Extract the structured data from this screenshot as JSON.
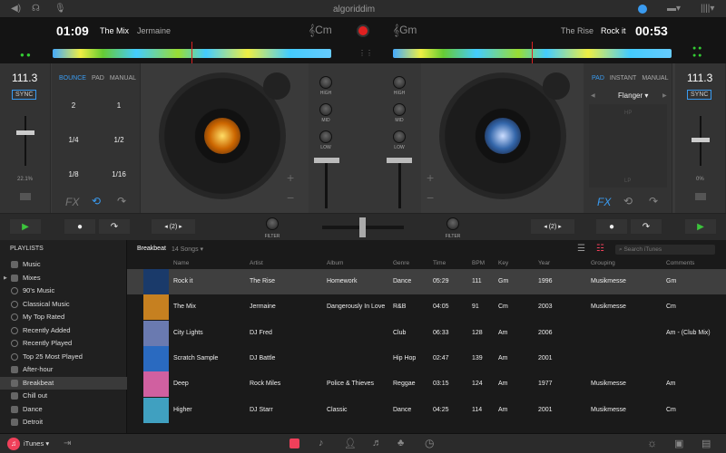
{
  "topbar": {
    "brand": "algoriddim",
    "icons": [
      "speaker-icon",
      "headphones-icon",
      "microphone-icon",
      "sync-icon",
      "layout-icon",
      "columns-icon"
    ]
  },
  "deck_a": {
    "time": "01:09",
    "title": "The Mix",
    "artist": "Jermaine",
    "key": "Cm",
    "bpm": "111.3",
    "sync": "SYNC",
    "pitch": "22.1%",
    "tabs": [
      "BOUNCE",
      "PAD",
      "MANUAL"
    ],
    "active_tab": "BOUNCE",
    "pads": [
      "2",
      "1",
      "1/4",
      "1/2",
      "1/8",
      "1/16"
    ],
    "fx": "FX",
    "loop_value": "2"
  },
  "deck_b": {
    "time": "00:53",
    "title": "Rock it",
    "artist": "The Rise",
    "key": "Gm",
    "bpm": "111.3",
    "sync": "SYNC",
    "pitch": "0%",
    "tabs": [
      "PAD",
      "INSTANT",
      "MANUAL"
    ],
    "active_tab": "PAD",
    "effect": "Flanger",
    "hp": "HP",
    "lp": "LP",
    "fx": "FX",
    "loop_value": "2"
  },
  "mixer": {
    "high": "HIGH",
    "mid": "MID",
    "low": "LOW",
    "filter": "FILTER"
  },
  "library": {
    "sidebar_title": "PLAYLISTS",
    "playlists": [
      {
        "label": "Music",
        "icon": "playlist"
      },
      {
        "label": "Mixes",
        "icon": "folder"
      },
      {
        "label": "90's Music",
        "icon": "smart"
      },
      {
        "label": "Classical Music",
        "icon": "smart"
      },
      {
        "label": "My Top Rated",
        "icon": "smart"
      },
      {
        "label": "Recently Added",
        "icon": "smart"
      },
      {
        "label": "Recently Played",
        "icon": "smart"
      },
      {
        "label": "Top 25 Most Played",
        "icon": "smart"
      },
      {
        "label": "After-hour",
        "icon": "playlist"
      },
      {
        "label": "Breakbeat",
        "icon": "playlist"
      },
      {
        "label": "Chill out",
        "icon": "playlist"
      },
      {
        "label": "Dance",
        "icon": "playlist"
      },
      {
        "label": "Detroit",
        "icon": "playlist"
      }
    ],
    "selected": "Breakbeat",
    "title": "Breakbeat",
    "count": "14 Songs",
    "search_placeholder": "Search iTunes",
    "columns": [
      "Name",
      "Artist",
      "Album",
      "Genre",
      "Time",
      "BPM",
      "Key",
      "Year",
      "Grouping",
      "Comments"
    ],
    "rows": [
      [
        "Rock it",
        "The Rise",
        "Homework",
        "Dance",
        "05:29",
        "111",
        "Gm",
        "1996",
        "Musikmesse",
        "Gm"
      ],
      [
        "The Mix",
        "Jermaine",
        "Dangerously In Love",
        "R&B",
        "04:05",
        "91",
        "Cm",
        "2003",
        "Musikmesse",
        "Cm"
      ],
      [
        "City Lights",
        "DJ Fred",
        "",
        "Club",
        "06:33",
        "128",
        "Am",
        "2006",
        "",
        "Am - (Club Mix)"
      ],
      [
        "Scratch Sample",
        "DJ Battle",
        "",
        "Hip Hop",
        "02:47",
        "139",
        "Am",
        "2001",
        "",
        ""
      ],
      [
        "Deep",
        "Rock Miles",
        "Police & Thieves",
        "Reggae",
        "03:15",
        "124",
        "Am",
        "1977",
        "Musikmesse",
        "Am"
      ],
      [
        "Higher",
        "DJ Starr",
        "Classic",
        "Dance",
        "04:25",
        "114",
        "Am",
        "2001",
        "Musikmesse",
        "Cm"
      ]
    ],
    "thumb_colors": [
      "#1a3a6a",
      "#c68020",
      "#6a7ab0",
      "#2a6ac0",
      "#d060a0",
      "#40a0c0"
    ]
  },
  "bottom": {
    "source": "iTunes"
  },
  "colors": {
    "accent": "#3a9bf0",
    "play": "#3cc43c",
    "record": "#e02020",
    "itunes": "#f0405a"
  }
}
